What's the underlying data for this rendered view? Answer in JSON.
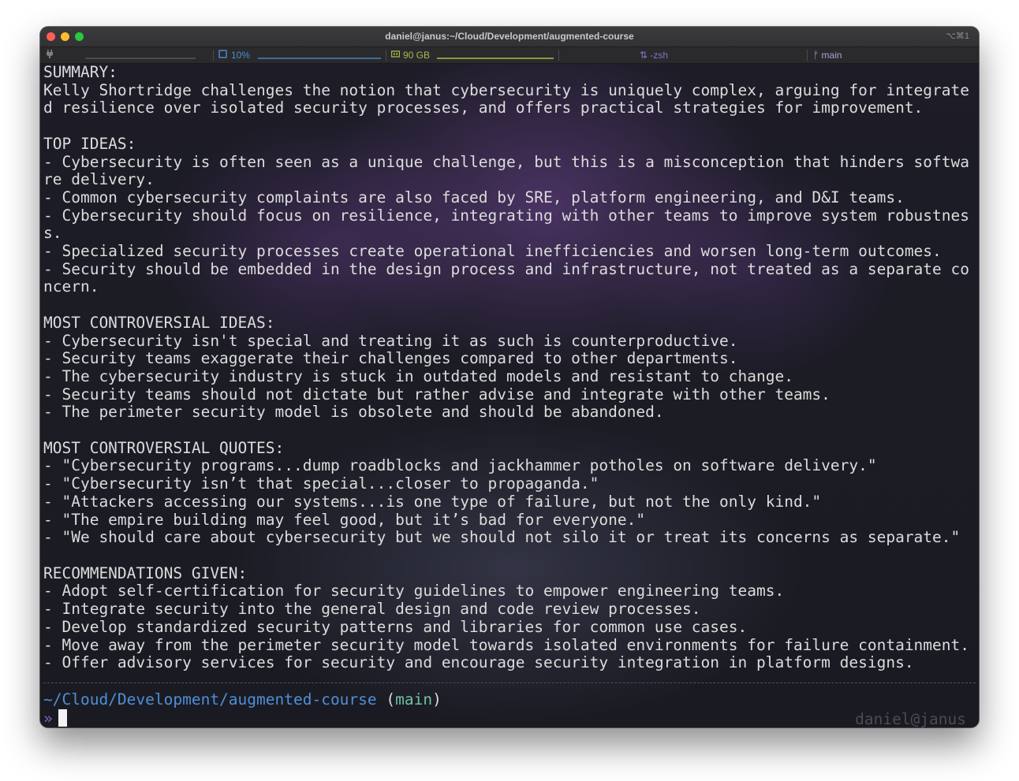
{
  "window": {
    "title": "daniel@janus:~/Cloud/Development/augmented-course",
    "shortcut": "⌥⌘1"
  },
  "statusbar": {
    "plug_icon": "plug-icon",
    "cpu_icon": "cpu-icon",
    "cpu_text": "10%",
    "memory_icon": "memory-icon",
    "memory_text": "90 GB",
    "shell_icon": "shell-icon",
    "shell_text": "-zsh",
    "branch_icon": "branch-icon",
    "branch_text": "main",
    "colors": {
      "cpu": "#4a8ed6",
      "memory": "#a8b84a",
      "shell": "#8a6fc7"
    }
  },
  "terminal": {
    "output_lines": [
      "SUMMARY:",
      "Kelly Shortridge challenges the notion that cybersecurity is uniquely complex, arguing for integrate",
      "d resilience over isolated security processes, and offers practical strategies for improvement.",
      "",
      "TOP IDEAS:",
      "- Cybersecurity is often seen as a unique challenge, but this is a misconception that hinders softwa",
      "re delivery.",
      "- Common cybersecurity complaints are also faced by SRE, platform engineering, and D&I teams.",
      "- Cybersecurity should focus on resilience, integrating with other teams to improve system robustnes",
      "s.",
      "- Specialized security processes create operational inefficiencies and worsen long-term outcomes.",
      "- Security should be embedded in the design process and infrastructure, not treated as a separate co",
      "ncern.",
      "",
      "MOST CONTROVERSIAL IDEAS:",
      "- Cybersecurity isn't special and treating it as such is counterproductive.",
      "- Security teams exaggerate their challenges compared to other departments.",
      "- The cybersecurity industry is stuck in outdated models and resistant to change.",
      "- Security teams should not dictate but rather advise and integrate with other teams.",
      "- The perimeter security model is obsolete and should be abandoned.",
      "",
      "MOST CONTROVERSIAL QUOTES:",
      "- \"Cybersecurity programs...dump roadblocks and jackhammer potholes on software delivery.\"",
      "- \"Cybersecurity isn’t that special...closer to propaganda.\"",
      "- \"Attackers accessing our systems...is one type of failure, but not the only kind.\"",
      "- \"The empire building may feel good, but it’s bad for everyone.\"",
      "- \"We should care about cybersecurity but we should not silo it or treat its concerns as separate.\"",
      "",
      "RECOMMENDATIONS GIVEN:",
      "- Adopt self-certification for security guidelines to empower engineering teams.",
      "- Integrate security into the general design and code review processes.",
      "- Develop standardized security patterns and libraries for common use cases.",
      "- Move away from the perimeter security model towards isolated environments for failure containment.",
      "- Offer advisory services for security and encourage security integration in platform designs."
    ],
    "prompt_path": "~/Cloud/Development/augmented-course",
    "prompt_branch_open": " (",
    "prompt_branch": "main",
    "prompt_branch_close": ")",
    "prompt_symbol": "»",
    "right_prompt": "daniel@janus"
  }
}
